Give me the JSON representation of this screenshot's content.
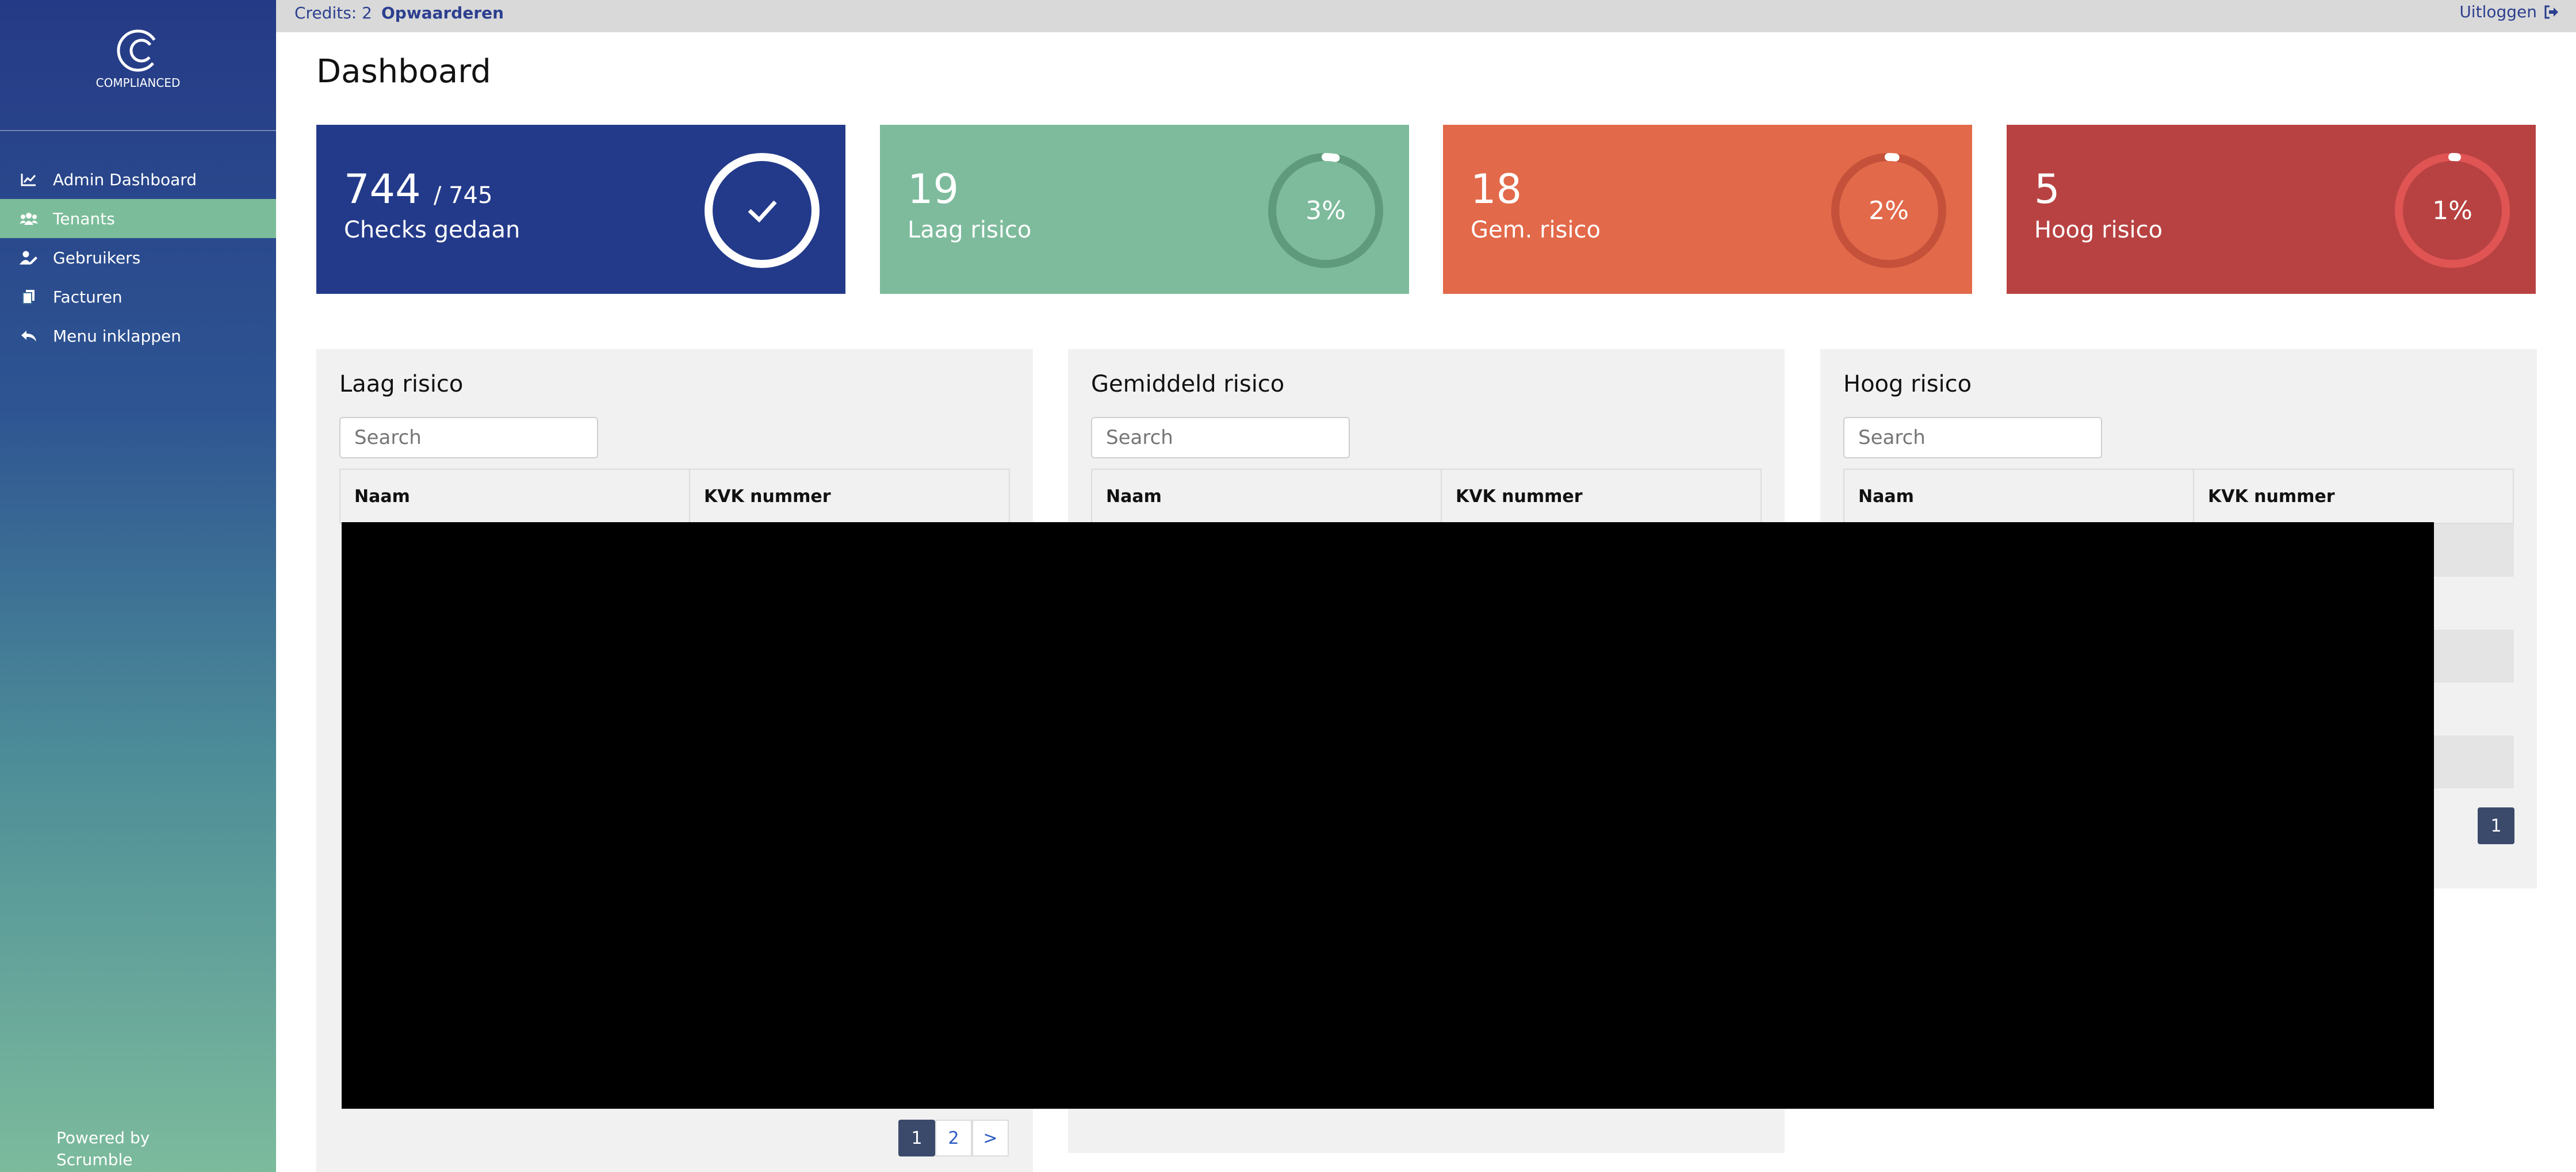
{
  "sidebar": {
    "logo_text": "COMPLIANCED",
    "items": [
      {
        "label": "Admin Dashboard",
        "icon": "chart-line-icon"
      },
      {
        "label": "Tenants",
        "icon": "users-icon",
        "active": true
      },
      {
        "label": "Gebruikers",
        "icon": "user-edit-icon"
      },
      {
        "label": "Facturen",
        "icon": "copy-icon"
      },
      {
        "label": "Menu inklappen",
        "icon": "reply-icon"
      }
    ],
    "powered_by": "Powered by",
    "powered_by_name": "Scrumble"
  },
  "topbar": {
    "credits": "Credits: 2",
    "topup": "Opwaarderen",
    "logout": "Uitloggen"
  },
  "page": {
    "title": "Dashboard"
  },
  "cards": [
    {
      "value": "744",
      "total": "/ 745",
      "label": "Checks gedaan",
      "color": "#233a8a",
      "percent_text": ""
    },
    {
      "value": "19",
      "label": "Laag risico",
      "percent_text": "3%",
      "percent": 3,
      "color": "#7dbb9c"
    },
    {
      "value": "18",
      "label": "Gem. risico",
      "percent_text": "2%",
      "percent": 2,
      "color": "#e2694a"
    },
    {
      "value": "5",
      "label": "Hoog risico",
      "percent_text": "1%",
      "percent": 1,
      "color": "#b84242"
    }
  ],
  "panels": [
    {
      "title": "Laag risico",
      "search_placeholder": "Search",
      "col1": "Naam",
      "col2": "KVK nummer",
      "pages": [
        "1",
        "2",
        ">"
      ]
    },
    {
      "title": "Gemiddeld risico",
      "search_placeholder": "Search",
      "col1": "Naam",
      "col2": "KVK nummer"
    },
    {
      "title": "Hoog risico",
      "search_placeholder": "Search",
      "col1": "Naam",
      "col2": "KVK nummer",
      "pages": [
        "1"
      ]
    }
  ]
}
